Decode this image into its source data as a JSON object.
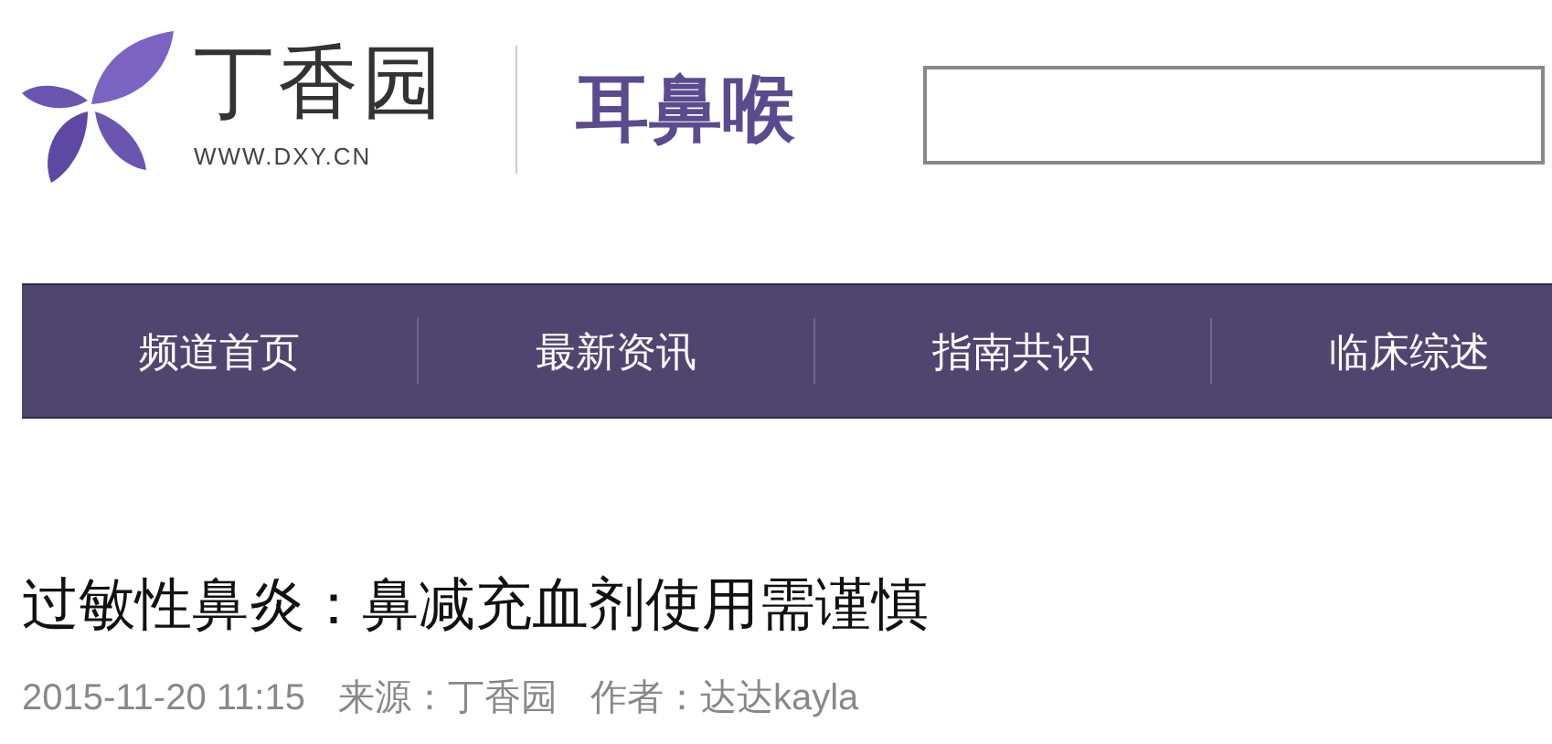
{
  "logo": {
    "name": "丁香园",
    "url": "WWW.DXY.CN"
  },
  "channel": "耳鼻喉",
  "nav": [
    {
      "label": "频道首页"
    },
    {
      "label": "最新资讯"
    },
    {
      "label": "指南共识"
    },
    {
      "label": "临床综述"
    }
  ],
  "article": {
    "title": "过敏性鼻炎：鼻减充血剂使用需谨慎",
    "date": "2015-11-20 11:15",
    "source": "来源：丁香园",
    "author": "作者：达达kayla"
  }
}
